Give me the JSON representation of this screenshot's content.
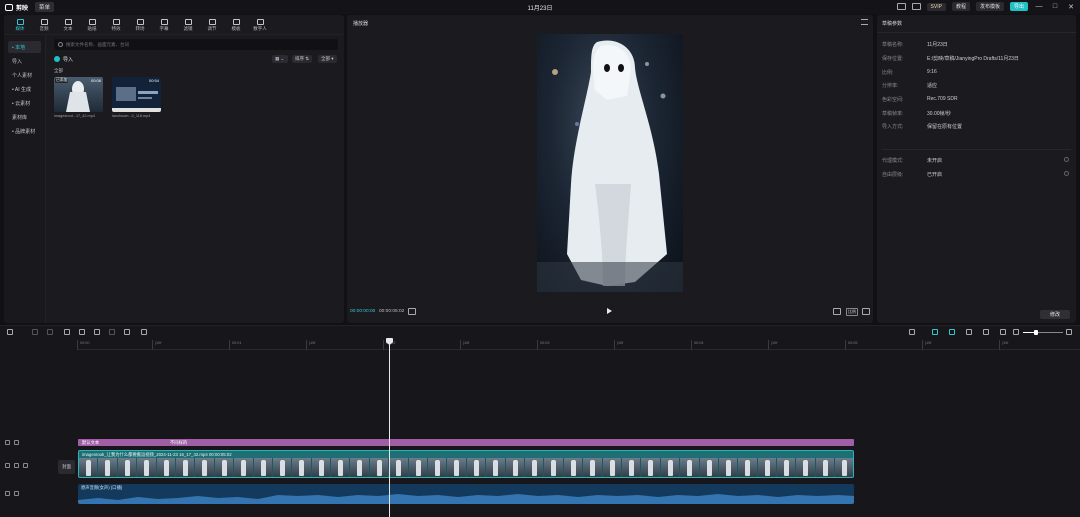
{
  "titlebar": {
    "app_name": "剪映",
    "menu_label": "菜单",
    "title": "11月23日",
    "svip_label": "SVIP",
    "chip1_label": "教程",
    "chip2_label": "发布模板",
    "export_label": "导出"
  },
  "toolbar": {
    "tools": [
      {
        "label": "媒体"
      },
      {
        "label": "音频"
      },
      {
        "label": "文本"
      },
      {
        "label": "贴纸"
      },
      {
        "label": "特效"
      },
      {
        "label": "转场"
      },
      {
        "label": "字幕"
      },
      {
        "label": "滤镜"
      },
      {
        "label": "调节"
      },
      {
        "label": "模板"
      },
      {
        "label": "数字人"
      }
    ]
  },
  "sidenav": {
    "items": [
      {
        "label": "• 本地"
      },
      {
        "label": "导入"
      },
      {
        "label": "个人素材"
      },
      {
        "label": "• AI 生成"
      },
      {
        "label": "• 云素材"
      },
      {
        "label": "素材库"
      },
      {
        "label": "• 品牌素材"
      }
    ]
  },
  "media": {
    "search_placeholder": "搜索文件名称、画面元素、台词",
    "import_label": "导入",
    "sort_label": "排序",
    "all_label": "全部",
    "section_label": "全部",
    "items": [
      {
        "badge": "已添加",
        "duration": "00:06",
        "name": "imagesrout...17_42.mp4"
      },
      {
        "duration": "00:54",
        "name": "lanzhoum...0_118.mp4"
      }
    ]
  },
  "player": {
    "title": "播放器",
    "current_time": "00:00:00:00",
    "total_time": "00:00:05:02",
    "ratio_label": "比例"
  },
  "props": {
    "title": "草稿参数",
    "rows": [
      {
        "key": "草稿名称:",
        "value": "11月23日"
      },
      {
        "key": "保存位置:",
        "value": "E:/剪映/草稿/JianyingPro Drafts/11月23日"
      },
      {
        "key": "比例:",
        "value": "9:16"
      },
      {
        "key": "分辨率:",
        "value": "适应"
      },
      {
        "key": "色彩空间:",
        "value": "Rec.709 SDR"
      },
      {
        "key": "草稿帧率:",
        "value": "30.00帧/秒"
      },
      {
        "key": "导入方式:",
        "value": "保留在原有位置"
      },
      {
        "key": "代理模式:",
        "value": "未开启"
      },
      {
        "key": "自由层级:",
        "value": "已开启"
      }
    ],
    "edit_label": "修改"
  },
  "timeline": {
    "ticks": [
      "00:00",
      "|10f",
      "00:01",
      "|10f",
      "00:02",
      "|10f",
      "00:03",
      "|10f",
      "00:04",
      "|10f",
      "00:05",
      "|10f",
      "|10f"
    ],
    "cover_label": "封面",
    "text_clip1": "默认文本",
    "text_clip2": "不同样的",
    "video_clip_label": "imagesrouk_让我为什么都要搬运视频_2024-11-23 16_17_42.mp4  00:00:05:02",
    "audio_clip_label": "原声音频(女声)  (口播)"
  }
}
